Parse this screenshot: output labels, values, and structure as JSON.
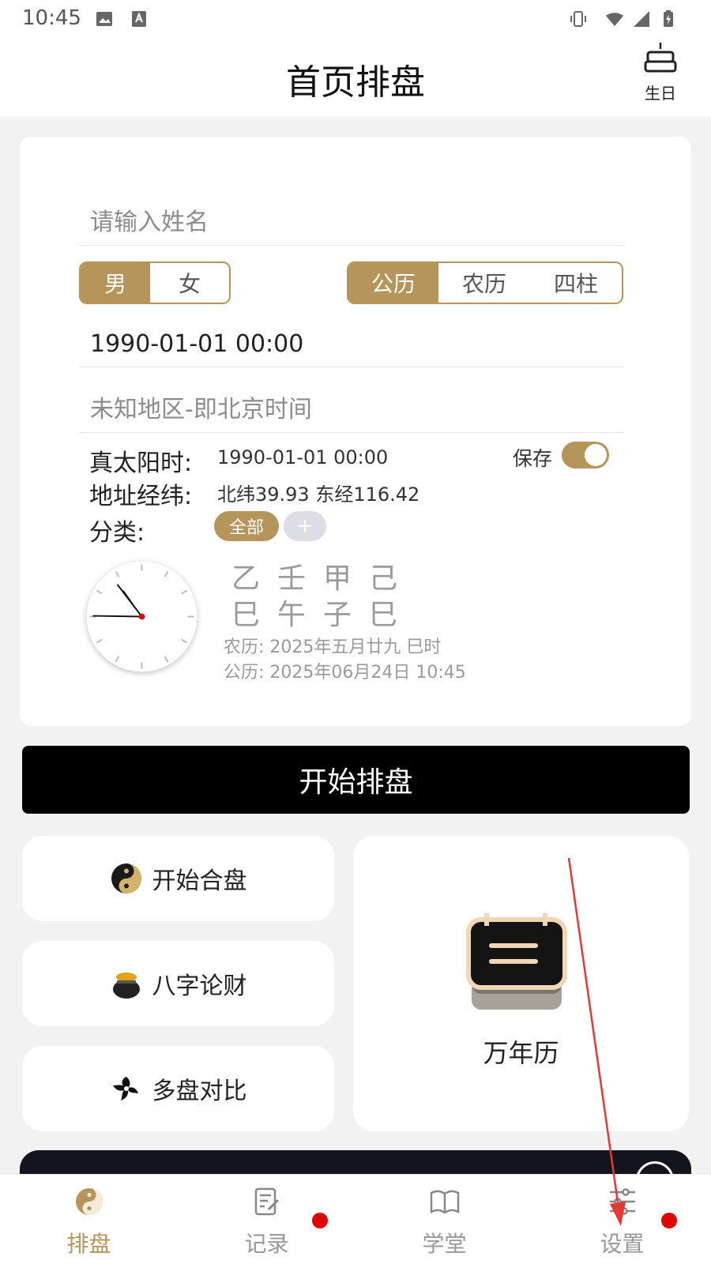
{
  "status_bar": {
    "time": "10:45"
  },
  "header": {
    "title": "首页排盘",
    "birthday_label": "生日"
  },
  "form": {
    "name_placeholder": "请输入姓名",
    "gender": {
      "options": [
        "男",
        "女"
      ],
      "selected": "男"
    },
    "calendar_type": {
      "options": [
        "公历",
        "农历",
        "四柱"
      ],
      "selected": "公历"
    },
    "datetime": "1990-01-01 00:00",
    "region": "未知地区-即北京时间"
  },
  "info": {
    "solar_time_label": "真太阳时:",
    "solar_time_value": "1990-01-01 00:00",
    "save_label": "保存",
    "save_on": true,
    "coord_label": "地址经纬:",
    "coord_value": "北纬39.93 东经116.42",
    "category_label": "分类:",
    "category_chips": [
      "全部",
      "+"
    ]
  },
  "bazi": {
    "stems": "乙壬甲己",
    "branches": "巳午子巳",
    "lunar": "农历: 2025年五月廿九 巳时",
    "solar": "公历: 2025年06月24日 10:45"
  },
  "actions": {
    "start_label": "开始排盘",
    "hepan_label": "开始合盘",
    "money_label": "八字论财",
    "compare_label": "多盘对比",
    "calendar_label": "万年历"
  },
  "tabbar": {
    "tabs": [
      {
        "label": "排盘",
        "active": true,
        "badge": false
      },
      {
        "label": "记录",
        "active": false,
        "badge": true
      },
      {
        "label": "学堂",
        "active": false,
        "badge": false
      },
      {
        "label": "设置",
        "active": false,
        "badge": true
      }
    ]
  },
  "colors": {
    "accent": "#b5955a",
    "badge": "#e00000",
    "annotation_arrow": "#e53935"
  }
}
